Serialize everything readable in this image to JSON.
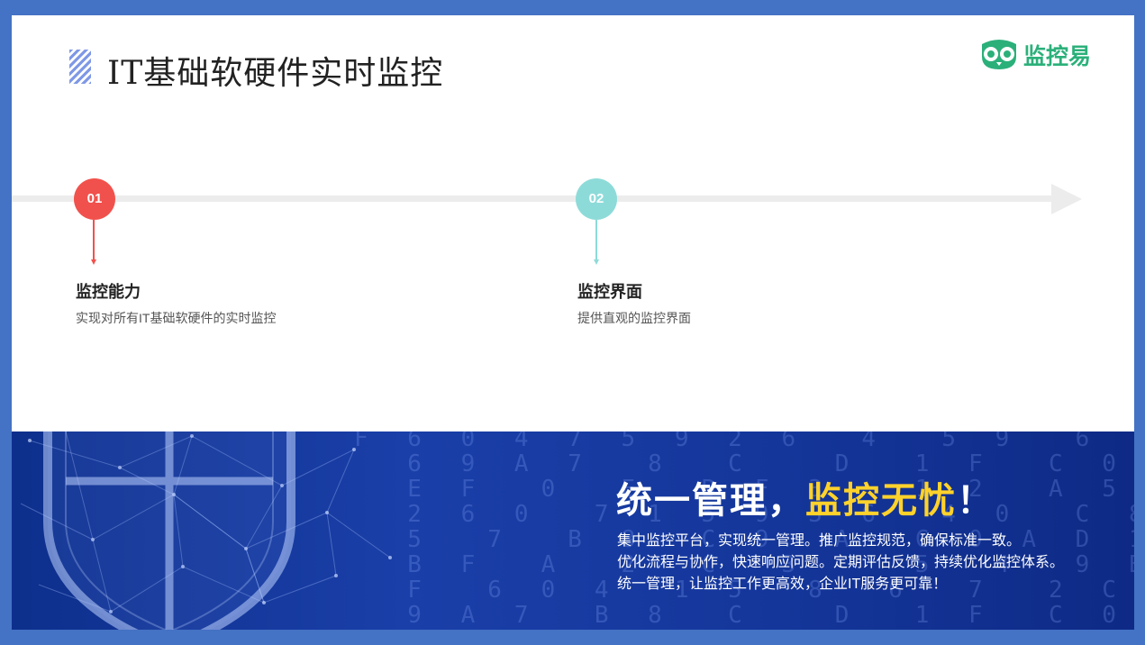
{
  "slide": {
    "title": "IT基础软硬件实时监控",
    "logo": {
      "text": "监控易"
    }
  },
  "timeline": {
    "steps": [
      {
        "number": "01",
        "title": "监控能力",
        "desc": "实现对所有IT基础软硬件的实时监控",
        "color": "#f1514c"
      },
      {
        "number": "02",
        "title": "监控界面",
        "desc": "提供直观的监控界面",
        "color": "#8ddbd9"
      }
    ]
  },
  "banner": {
    "heading_white": "统一管理，",
    "heading_highlight": "监控无忧",
    "heading_tail": "！",
    "lines": [
      "集中监控平台，实现统一管理。推广监控规范，确保标准一致。",
      "优化流程与协作，快速响应问题。定期评估反馈，持续优化监控体系。",
      "统一管理，让监控工作更高效，企业IT服务更可靠！"
    ],
    "digits": "F 6 0 4 7 5 9 2 6  4  5 9  6\n  6 9 A 7  8  C   D  1 F  C 0  1  E 2 C\n  E F  0  E  B F 3   1 2  A 5 1 8  F\n  2 6 0  7 1 5 9 3 6  4 0  C 8 A 7\n  5  7  B 8  C 9  A  C 0 A D 1 D F 2\n  B F  A  2  C  3    5  4  9 B 3  4\n  F  6 0 4  1 5  8  6  7  2 C 0  E\n  9 A 7  B 8  C   D  1 F  C 0 4 D 5\n  F  0 E  F 1 B   4 2  F 3 6  2 7"
  }
}
